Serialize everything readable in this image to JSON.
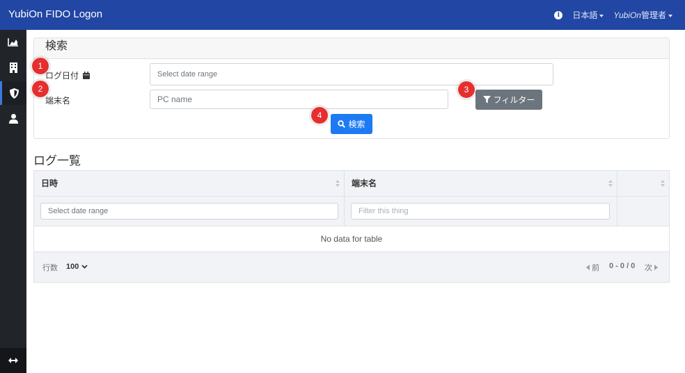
{
  "header": {
    "brand": "YubiOn FIDO Logon",
    "language": "日本語",
    "user_prefix": "YubiOn",
    "user_suffix": "管理者"
  },
  "sidebar": {
    "items": [
      {
        "icon": "chart-area-icon"
      },
      {
        "icon": "building-icon"
      },
      {
        "icon": "shield-icon",
        "active": true
      },
      {
        "icon": "user-icon"
      }
    ],
    "toggle_icon": "arrows-horizontal-icon"
  },
  "search_panel": {
    "title": "検索",
    "date_label": "ログ日付",
    "date_placeholder": "Select date range",
    "pc_label": "端末名",
    "pc_placeholder": "PC name",
    "filter_button": "フィルター",
    "search_button": "検索"
  },
  "badges": [
    "1",
    "2",
    "3",
    "4"
  ],
  "log_table": {
    "title": "ログ一覧",
    "columns": [
      "日時",
      "端末名",
      ""
    ],
    "date_filter_placeholder": "Select date range",
    "name_filter_placeholder": "Filter this thing",
    "empty_text": "No data for table",
    "footer": {
      "rows_label": "行数",
      "rows_value": "100",
      "prev": "前",
      "range": "0 - 0 / 0",
      "next": "次"
    }
  },
  "colors": {
    "topbar": "#2146a3",
    "sidebar": "#212529",
    "primary": "#1d7af3",
    "secondary": "#6c757d",
    "badge": "#e52f2f"
  }
}
